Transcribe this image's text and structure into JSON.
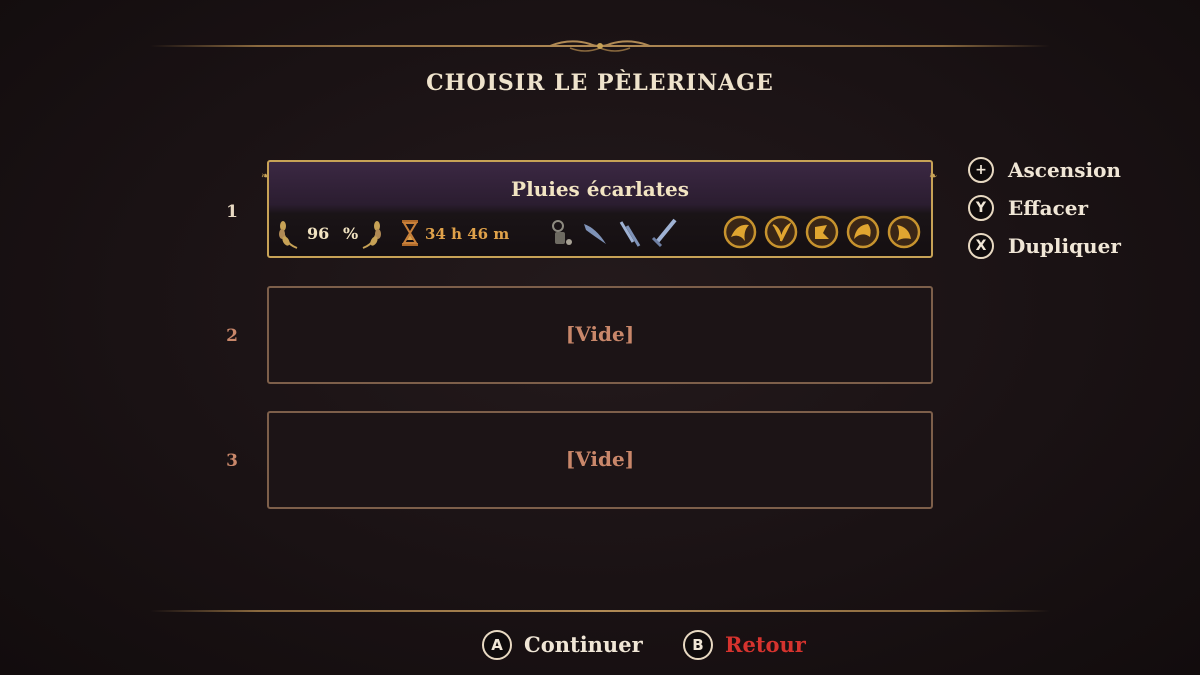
{
  "screen": {
    "title": "CHOISIR LE PÈLERINAGE"
  },
  "slots": [
    {
      "number": "1",
      "name": "Pluies écarlates",
      "completion": "96",
      "completion_unit": "%",
      "playtime": "34 h 46 m",
      "items": [
        "rosary-icon",
        "blade-icon",
        "twin-daggers-icon",
        "sword-icon"
      ],
      "medals": [
        "golden-medal-icon",
        "golden-medal-icon",
        "golden-medal-icon",
        "golden-medal-icon",
        "golden-medal-icon"
      ]
    },
    {
      "number": "2",
      "label": "[Vide]"
    },
    {
      "number": "3",
      "label": "[Vide]"
    }
  ],
  "side_actions": [
    {
      "button": "+",
      "label": "Ascension"
    },
    {
      "button": "Y",
      "label": "Effacer"
    },
    {
      "button": "X",
      "label": "Dupliquer"
    }
  ],
  "footer": {
    "continue": {
      "button": "A",
      "label": "Continuer"
    },
    "back": {
      "button": "B",
      "label": "Retour"
    }
  },
  "colors": {
    "background": "#1a1214",
    "gold_border": "#c7a256",
    "empty_text": "#c9876a",
    "back_red": "#d6332e"
  }
}
